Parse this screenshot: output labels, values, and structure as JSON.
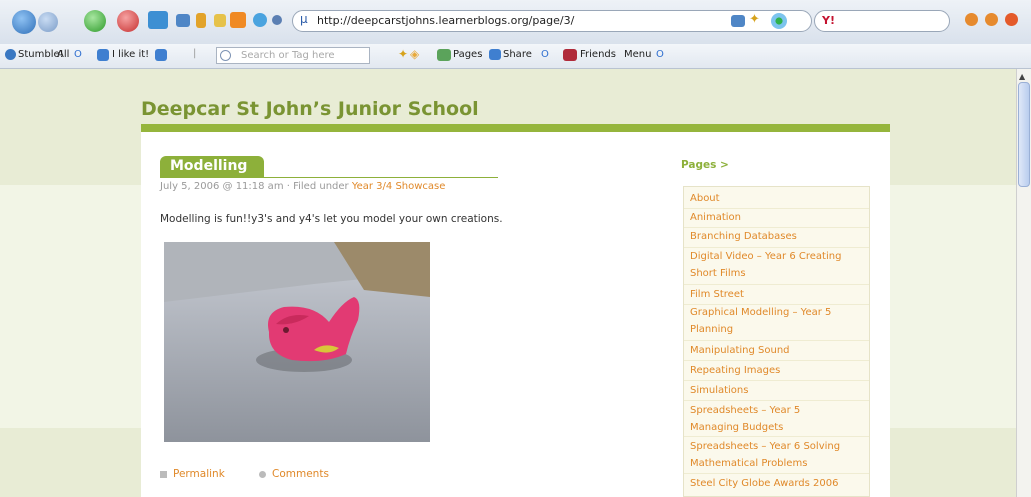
{
  "browser": {
    "url": "http://deepcarstjohns.learnerblogs.org/page/3/",
    "toolbar": {
      "stumble_label": "Stumble!",
      "all_label": "All",
      "all_count": "O",
      "ilikeit_label": "I like it!",
      "search_placeholder": "Search or Tag here",
      "pages_label": "Pages",
      "share_label": "Share",
      "share_count": "O",
      "friends_label": "Friends",
      "menu_label": "Menu",
      "menu_count": "O"
    }
  },
  "site": {
    "title": "Deepcar St John’s Junior School"
  },
  "post": {
    "title": "Modelling",
    "meta_prefix": "July 5, 2006 @ 11:18 am · Filed under ",
    "category": "Year 3/4 Showcase",
    "body": "Modelling is fun!!y3's and y4's let you model your own creations.",
    "permalink_label": "Permalink",
    "comments_label": "Comments"
  },
  "sidebar": {
    "heading": "Pages >",
    "items": [
      {
        "label": "About"
      },
      {
        "label": "Animation"
      },
      {
        "label": "Branching Databases"
      },
      {
        "label": "Digital Video – Year 6 Creating",
        "label2": "Short Films"
      },
      {
        "label": "Film Street"
      },
      {
        "label": "Graphical Modelling – Year 5",
        "label2": "Planning"
      },
      {
        "label": "Manipulating Sound"
      },
      {
        "label": "Repeating Images"
      },
      {
        "label": "Simulations"
      },
      {
        "label": "Spreadsheets – Year 5",
        "label2": "Managing Budgets"
      },
      {
        "label": "Spreadsheets – Year 6 Solving",
        "label2": "Mathematical Problems"
      },
      {
        "label": "Steel City Globe Awards 2006"
      }
    ]
  },
  "colors": {
    "accent_green": "#8db03a",
    "link_orange": "#e0892a",
    "page_bg": "#e8ecd5"
  }
}
